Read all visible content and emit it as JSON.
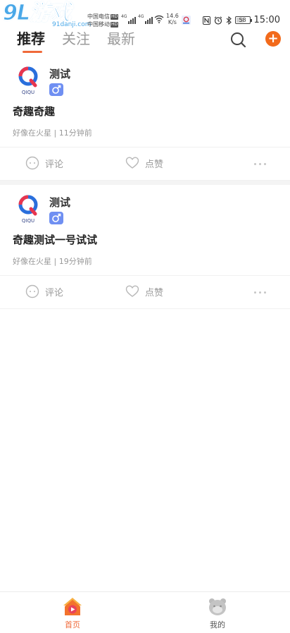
{
  "status_bar": {
    "watermark_text": "9L游戏",
    "watermark_url": "91danji.com",
    "carrier_1": "中国电信",
    "carrier_2": "中国移动",
    "hd_badge": "HD",
    "net_type": "4G",
    "net_speed_value": "14.6",
    "net_speed_unit": "K/s",
    "battery_level": "58",
    "battery_fraction": 0.58,
    "time": "15:00"
  },
  "header": {
    "tabs": [
      {
        "label": "推荐",
        "active": true
      },
      {
        "label": "关注",
        "active": false
      },
      {
        "label": "最新",
        "active": false
      }
    ],
    "accent_color": "#f06a3a",
    "add_label": "+"
  },
  "posts": [
    {
      "author": "测试",
      "avatar_text": "QIQU",
      "title": "奇趣奇趣",
      "meta": "好像在火星 | 11分钟前",
      "comment_label": "评论",
      "like_label": "点赞"
    },
    {
      "author": "测试",
      "avatar_text": "QIQU",
      "title": "奇趣测试一号试试",
      "meta": "好像在火星 | 19分钟前",
      "comment_label": "评论",
      "like_label": "点赞"
    }
  ],
  "bottom_nav": {
    "items": [
      {
        "label": "首页",
        "icon": "home-icon",
        "active": true
      },
      {
        "label": "我的",
        "icon": "profile-icon",
        "active": false
      }
    ]
  }
}
